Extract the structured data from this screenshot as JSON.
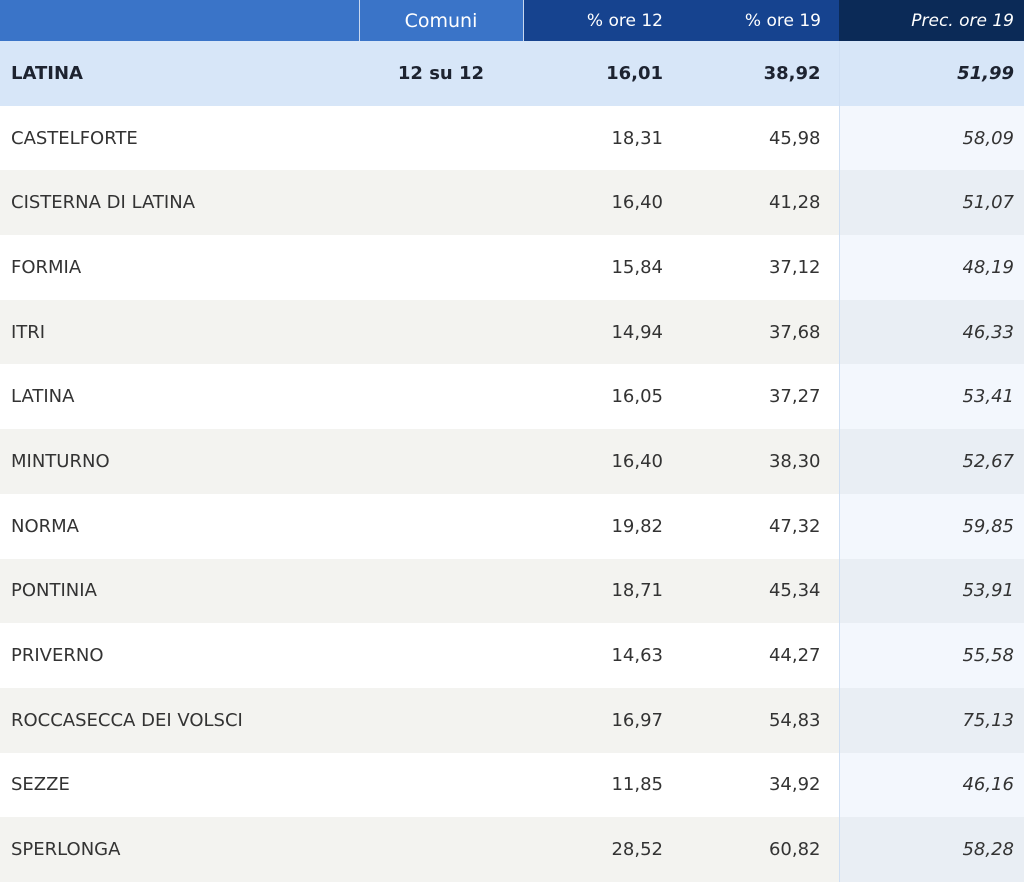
{
  "header": {
    "name": "",
    "comuni": "Comuni",
    "ore12": "% ore 12",
    "ore19": "% ore 19",
    "prec": "Prec. ore 19"
  },
  "total": {
    "name": "LATINA",
    "comuni": "12 su 12",
    "ore12": "16,01",
    "ore19": "38,92",
    "prec": "51,99"
  },
  "rows": [
    {
      "name": "CASTELFORTE",
      "ore12": "18,31",
      "ore19": "45,98",
      "prec": "58,09"
    },
    {
      "name": "CISTERNA DI LATINA",
      "ore12": "16,40",
      "ore19": "41,28",
      "prec": "51,07"
    },
    {
      "name": "FORMIA",
      "ore12": "15,84",
      "ore19": "37,12",
      "prec": "48,19"
    },
    {
      "name": "ITRI",
      "ore12": "14,94",
      "ore19": "37,68",
      "prec": "46,33"
    },
    {
      "name": "LATINA",
      "ore12": "16,05",
      "ore19": "37,27",
      "prec": "53,41"
    },
    {
      "name": "MINTURNO",
      "ore12": "16,40",
      "ore19": "38,30",
      "prec": "52,67"
    },
    {
      "name": "NORMA",
      "ore12": "19,82",
      "ore19": "47,32",
      "prec": "59,85"
    },
    {
      "name": "PONTINIA",
      "ore12": "18,71",
      "ore19": "45,34",
      "prec": "53,91"
    },
    {
      "name": "PRIVERNO",
      "ore12": "14,63",
      "ore19": "44,27",
      "prec": "55,58"
    },
    {
      "name": "ROCCASECCA DEI VOLSCI",
      "ore12": "16,97",
      "ore19": "54,83",
      "prec": "75,13"
    },
    {
      "name": "SEZZE",
      "ore12": "11,85",
      "ore19": "34,92",
      "prec": "46,16"
    },
    {
      "name": "SPERLONGA",
      "ore12": "28,52",
      "ore19": "60,82",
      "prec": "58,28"
    }
  ]
}
